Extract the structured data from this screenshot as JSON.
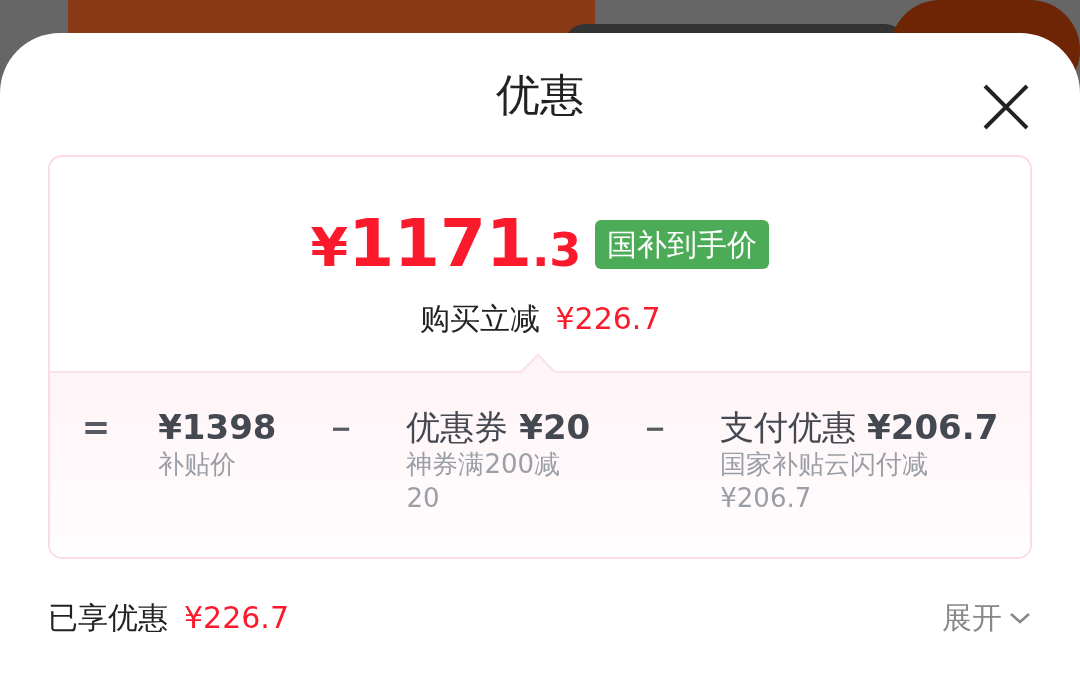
{
  "title": "优惠",
  "price": {
    "currency": "¥",
    "integer": "1171",
    "decimal": ".3",
    "badge": "国补到手价"
  },
  "instant_discount": {
    "label": "购买立减",
    "amount": "¥226.7"
  },
  "breakdown": [
    {
      "kind": "operator",
      "text": "="
    },
    {
      "kind": "term",
      "value": "¥1398",
      "note": "补贴价"
    },
    {
      "kind": "operator",
      "text": "－"
    },
    {
      "kind": "term",
      "label": "优惠券",
      "value": "¥20",
      "note": "神券满200减20"
    },
    {
      "kind": "operator",
      "text": "－"
    },
    {
      "kind": "term",
      "label": "支付优惠",
      "value": "¥206.7",
      "note": "国家补贴云闪付减¥206.7"
    }
  ],
  "summary": {
    "label": "已享优惠",
    "amount": "¥226.7",
    "toggle": "展开"
  }
}
